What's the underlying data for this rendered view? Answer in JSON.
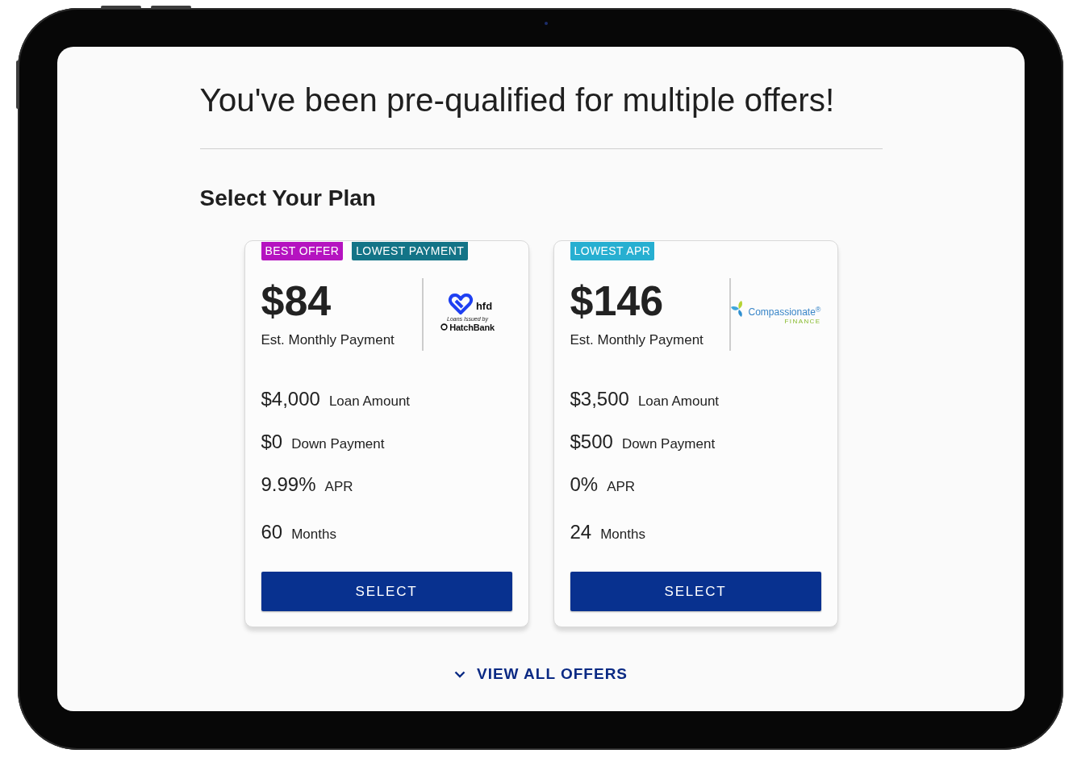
{
  "heading": "You've been pre-qualified for multiple offers!",
  "section_title": "Select Your Plan",
  "offers": [
    {
      "badges": [
        {
          "label": "BEST OFFER",
          "color": "#b513c0"
        },
        {
          "label": "LOWEST PAYMENT",
          "color": "#137487"
        }
      ],
      "monthly_payment": "$84",
      "monthly_payment_label": "Est. Monthly Payment",
      "lender_logo": {
        "kind": "hfd",
        "name": "hfd",
        "tagline": "Loans Issued by",
        "issuer": "HatchBank"
      },
      "details": [
        {
          "value": "$4,000",
          "label": "Loan Amount"
        },
        {
          "value": "$0",
          "label": "Down Payment"
        },
        {
          "value": "9.99%",
          "label": "APR"
        },
        {
          "value": "60",
          "label": "Months"
        }
      ],
      "button": "SELECT"
    },
    {
      "badges": [
        {
          "label": "LOWEST APR",
          "color": "#27afd1"
        }
      ],
      "monthly_payment": "$146",
      "monthly_payment_label": "Est. Monthly Payment",
      "lender_logo": {
        "kind": "compassionate",
        "name": "Compassionate$^{®}$",
        "tagline": "FINANCE"
      },
      "details": [
        {
          "value": "$3,500",
          "label": "Loan Amount"
        },
        {
          "value": "$500",
          "label": "Down Payment"
        },
        {
          "value": "0%",
          "label": "APR"
        },
        {
          "value": "24",
          "label": "Months"
        }
      ],
      "button": "SELECT"
    }
  ],
  "view_all": "VIEW ALL OFFERS"
}
